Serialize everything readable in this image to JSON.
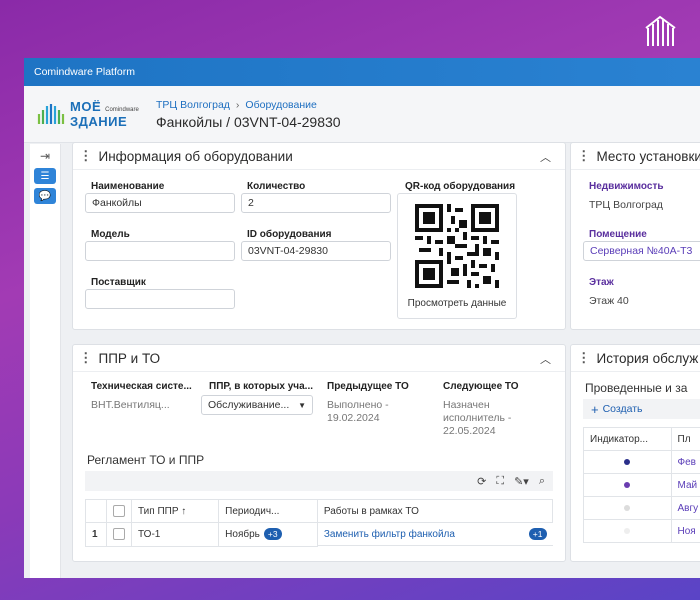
{
  "app": {
    "title": "Comindware Platform"
  },
  "brand": {
    "line1": "МОЁ",
    "line2": "ЗДАНИЕ",
    "sub": "Comindware"
  },
  "breadcrumb": {
    "items": [
      "ТРЦ Волгоград",
      "Оборудование"
    ],
    "separator": "›",
    "title": "Фанкойлы / 03VNT-04-29830"
  },
  "equipment_panel": {
    "title": "Информация об оборудовании",
    "name_label": "Наименование",
    "name_value": "Фанкойлы",
    "qty_label": "Количество",
    "qty_value": "2",
    "model_label": "Модель",
    "model_value": "",
    "id_label": "ID оборудования",
    "id_value": "03VNT-04-29830",
    "supplier_label": "Поставщик",
    "supplier_value": "",
    "qr_label": "QR-код оборудования",
    "qr_link": "Просмотреть данные"
  },
  "location_panel": {
    "title": "Место установки",
    "property_label": "Недвижимость",
    "property_value": "ТРЦ Волгоград",
    "room_label": "Помещение",
    "room_value": "Серверная №40А-Т3",
    "floor_label": "Этаж",
    "floor_value": "Этаж 40"
  },
  "ppr_panel": {
    "title": "ППР и ТО",
    "tech_system_label": "Техническая систе...",
    "tech_system_value": "ВНТ.Вентиляц...",
    "ppr_label": "ППР, в которых уча...",
    "ppr_value": "Обслуживание...",
    "prev_label": "Предыдущее ТО",
    "prev_value_line1": "Выполнено -",
    "prev_value_line2": "19.02.2024",
    "next_label": "Следующее ТО",
    "next_value_line1": "Назначен",
    "next_value_line2": "исполнитель -",
    "next_value_line3": "22.05.2024",
    "reglament_title": "Регламент ТО и ППР",
    "columns": [
      "Тип ППР ↑",
      "Периодич...",
      "Работы в рамках ТО"
    ],
    "rows": [
      {
        "num": "1",
        "type": "ТО-1",
        "period": "Ноябрь",
        "period_badge": "+3",
        "works": "Заменить фильтр фанкойла",
        "works_badge": "+1"
      }
    ]
  },
  "history_panel": {
    "title": "История обслуж",
    "subtitle": "Проведенные и за",
    "create_label": "Создать",
    "columns": [
      "Индикатор...",
      "Пл"
    ],
    "rows": [
      {
        "color": "#2a2f8a",
        "plan": "Фев"
      },
      {
        "color": "#6a3db0",
        "plan": "Май"
      },
      {
        "color": "#dcdcdc",
        "plan": "Авгу"
      },
      {
        "color": "#eeeeee",
        "plan": "Ноя"
      }
    ]
  },
  "colors": {
    "accent": "#1e74c4",
    "purple": "#5a2f9e",
    "badge": "#1e5fb0"
  }
}
